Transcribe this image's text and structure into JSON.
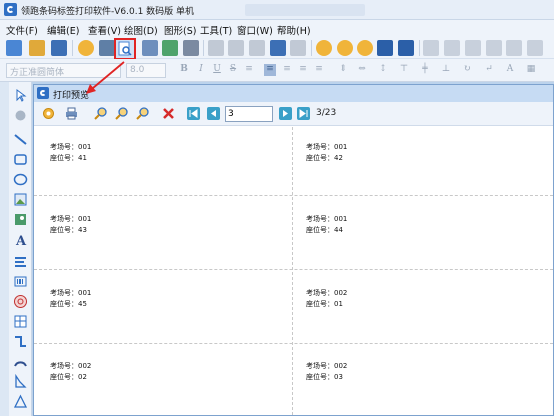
{
  "window": {
    "title": "领跑条码标签打印软件-V6.0.1 数码版 单机"
  },
  "menu": [
    "文件(F)",
    "编辑(E)",
    "查看(V)",
    "绘图(D)",
    "图形(S)",
    "工具(T)",
    "窗口(W)",
    "帮助(H)"
  ],
  "fontbar": {
    "font_name": "方正准圆简体",
    "font_size": "8.0"
  },
  "preview": {
    "title": "打印预览",
    "page_input": "3",
    "page_count": "3/23"
  },
  "labels": [
    {
      "exam_label": "考场号：001",
      "seat_label": "座位号：41"
    },
    {
      "exam_label": "考场号：001",
      "seat_label": "座位号：42"
    },
    {
      "exam_label": "考场号：001",
      "seat_label": "座位号：43"
    },
    {
      "exam_label": "考场号：001",
      "seat_label": "座位号：44"
    },
    {
      "exam_label": "考场号：001",
      "seat_label": "座位号：45"
    },
    {
      "exam_label": "考场号：002",
      "seat_label": "座位号：01"
    },
    {
      "exam_label": "考场号：002",
      "seat_label": "座位号：02"
    },
    {
      "exam_label": "考场号：002",
      "seat_label": "座位号：03"
    }
  ],
  "colors": {
    "accent": "#2f6fc4",
    "annotation": "#e02424"
  }
}
